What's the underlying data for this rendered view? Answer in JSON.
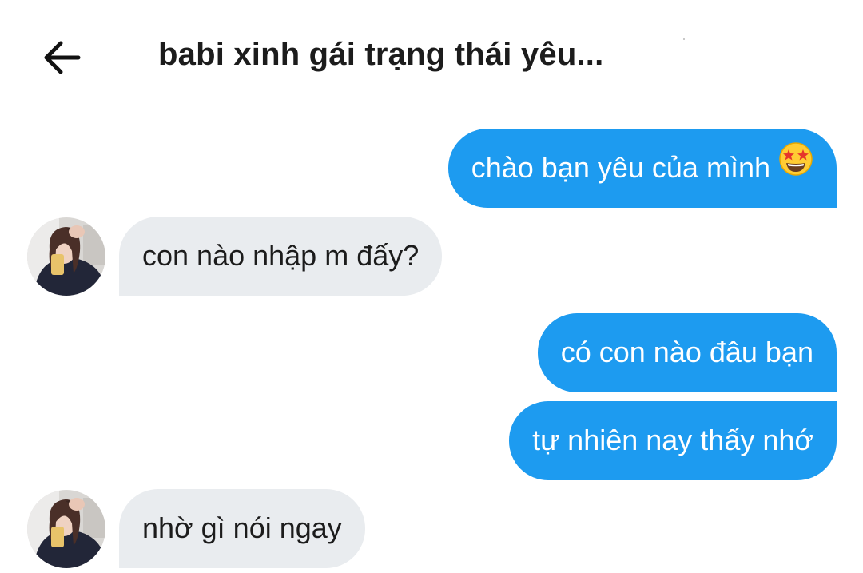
{
  "header": {
    "title": "babi xinh gái trạng thái yêu...",
    "back_icon": "arrow-left-icon"
  },
  "colors": {
    "sent_bubble": "#1d9bf0",
    "received_bubble": "#e9ecef",
    "sent_text": "#ffffff",
    "received_text": "#1c1c1c"
  },
  "messages": [
    {
      "sender": "me",
      "text": "chào bạn yêu của mình",
      "emoji": "star-struck-emoji"
    },
    {
      "sender": "them",
      "text": "con nào nhập m đấy?",
      "avatar": "avatar"
    },
    {
      "sender": "me",
      "text": "có con nào đâu bạn"
    },
    {
      "sender": "me",
      "text": "tự nhiên nay thấy nhớ"
    },
    {
      "sender": "them",
      "text": "nhờ gì nói ngay",
      "avatar": "avatar"
    }
  ]
}
